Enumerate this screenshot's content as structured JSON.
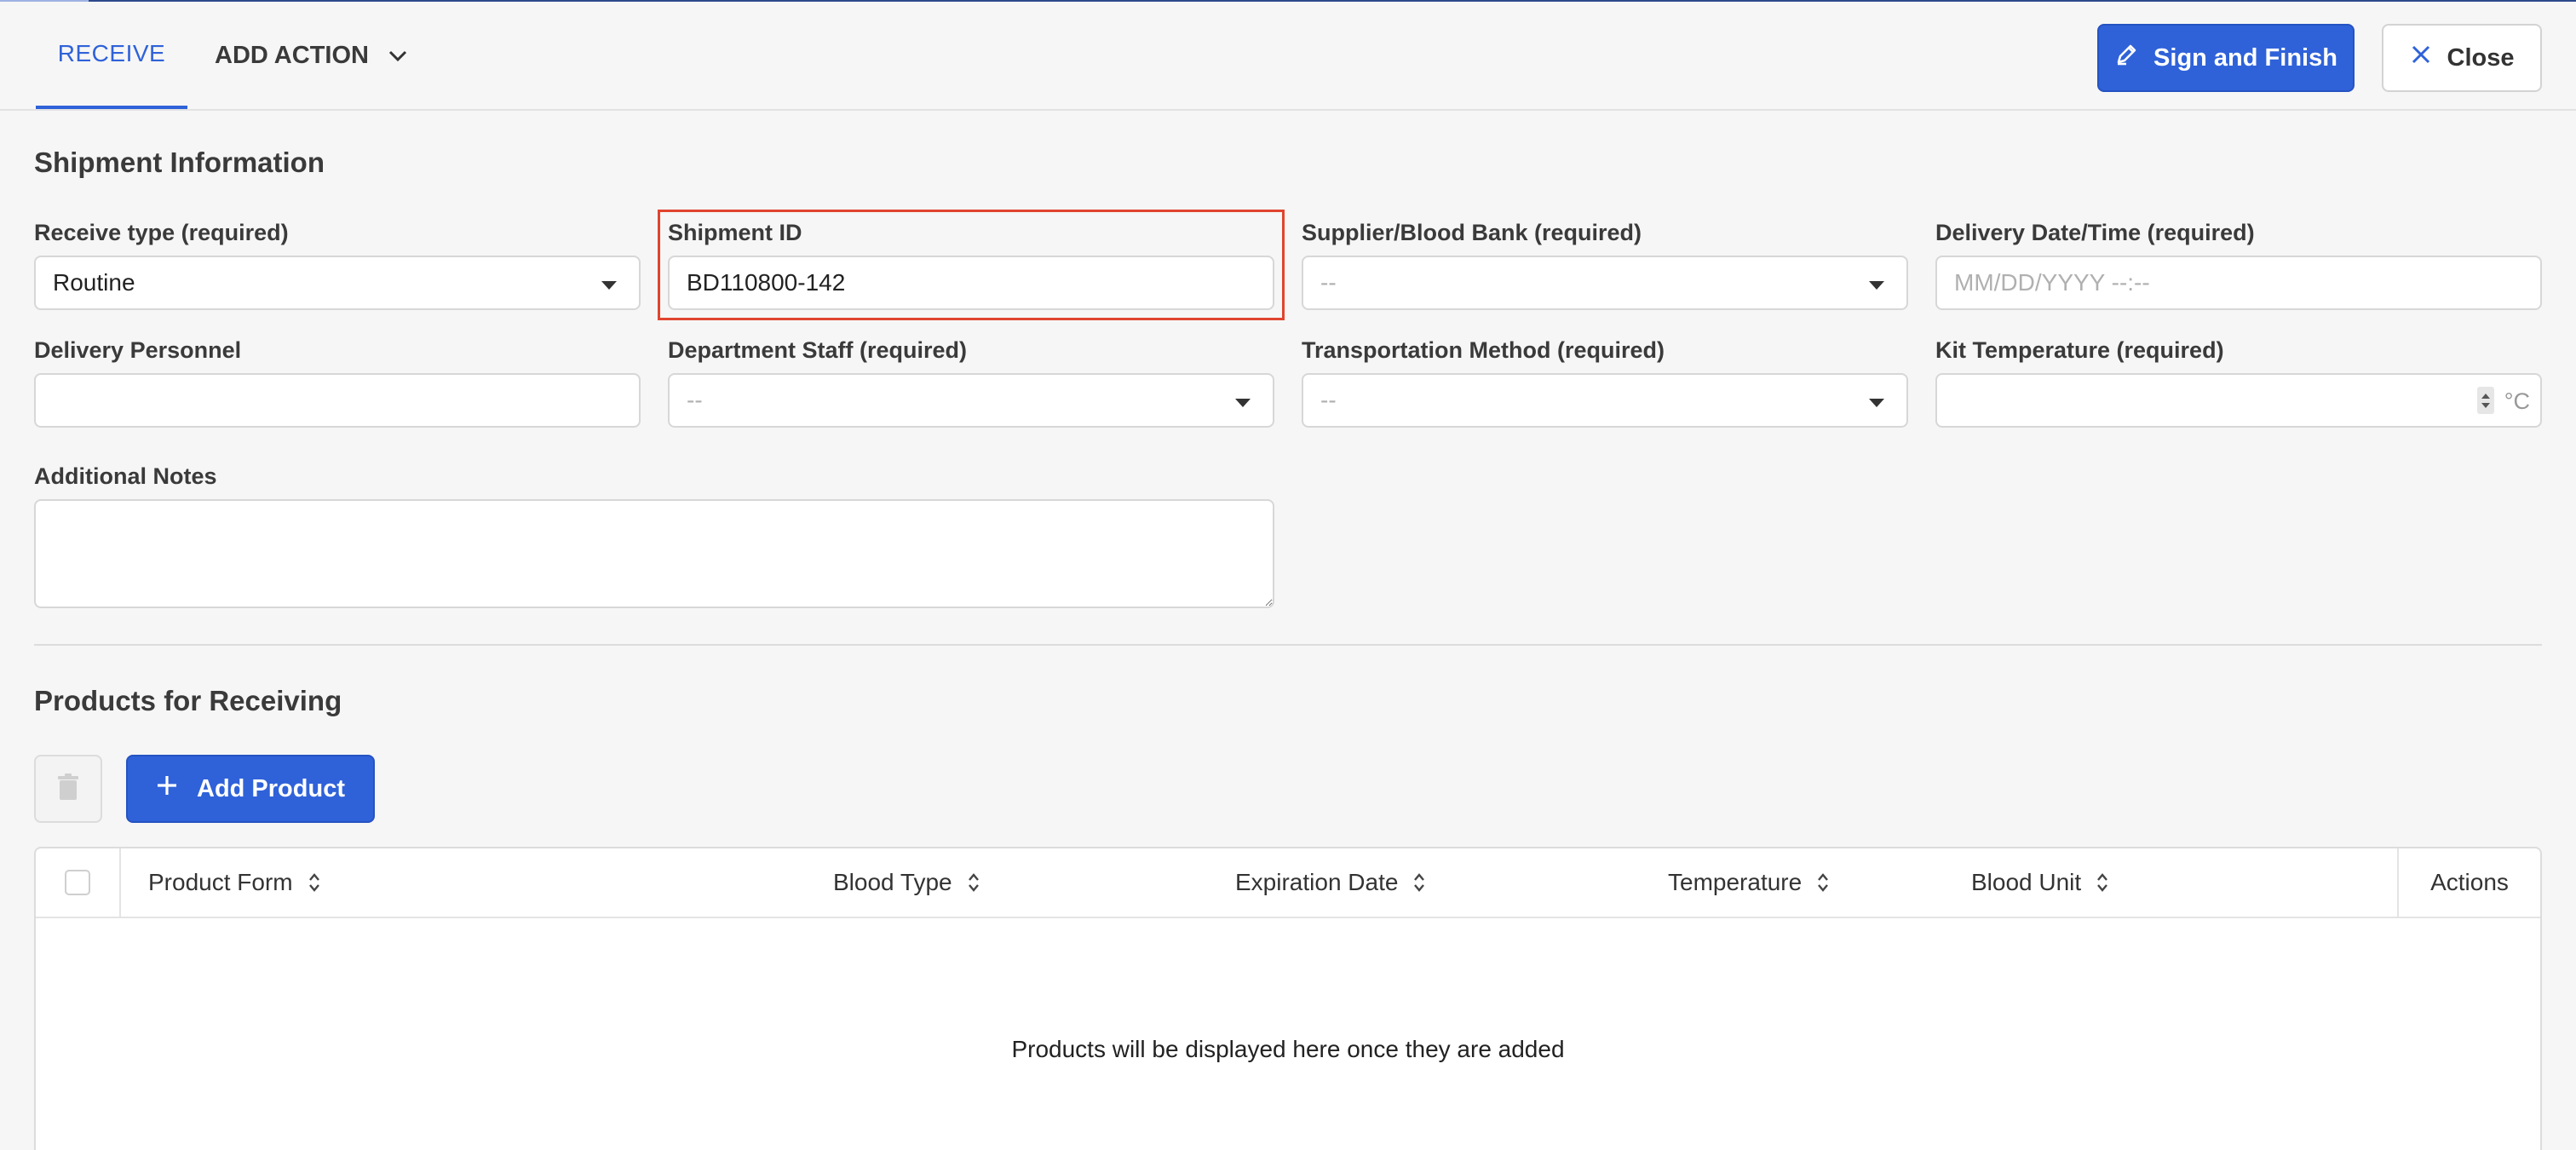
{
  "header": {
    "tabs": [
      {
        "label": "RECEIVE",
        "active": true
      },
      {
        "label": "ADD ACTION",
        "active": false
      }
    ],
    "sign_label": "Sign and Finish",
    "close_label": "Close"
  },
  "shipment": {
    "title": "Shipment Information",
    "receive_type": {
      "label": "Receive type (required)",
      "value": "Routine"
    },
    "shipment_id": {
      "label": "Shipment ID",
      "value": "BD110800-142"
    },
    "supplier": {
      "label": "Supplier/Blood Bank (required)",
      "value": "--"
    },
    "delivery_datetime": {
      "label": "Delivery Date/Time (required)",
      "placeholder": "MM/DD/YYYY --:--"
    },
    "delivery_personnel": {
      "label": "Delivery Personnel",
      "value": ""
    },
    "department_staff": {
      "label": "Department Staff (required)",
      "value": "--"
    },
    "transport_method": {
      "label": "Transportation Method (required)",
      "value": "--"
    },
    "kit_temperature": {
      "label": "Kit Temperature (required)",
      "unit": "°C",
      "value": ""
    },
    "additional_notes": {
      "label": "Additional Notes",
      "value": ""
    }
  },
  "products": {
    "title": "Products for Receiving",
    "add_label": "Add Product",
    "columns": [
      "Product Form",
      "Blood Type",
      "Expiration Date",
      "Temperature",
      "Blood Unit"
    ],
    "actions_label": "Actions",
    "empty_message": "Products will be displayed here once they are added"
  },
  "colors": {
    "accent": "#2f62d9",
    "highlight": "#e0442f"
  }
}
